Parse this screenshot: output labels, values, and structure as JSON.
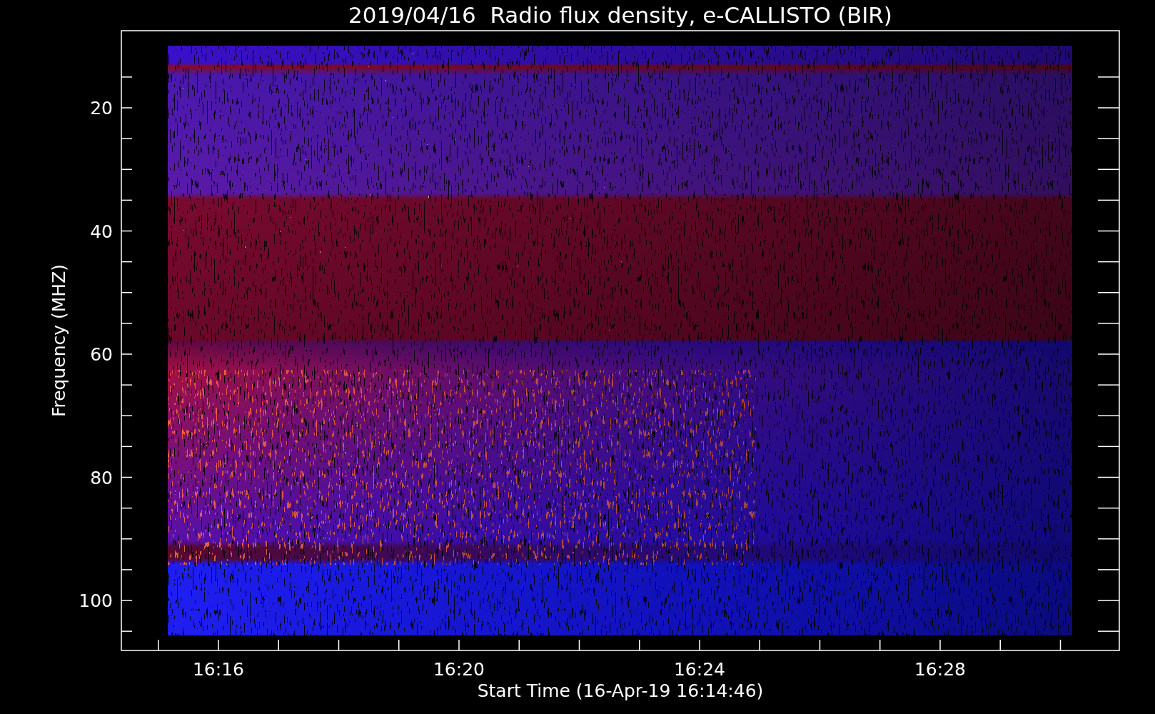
{
  "title": "2019/04/16  Radio flux density, e-CALLISTO (BIR)",
  "y_axis": {
    "label": "Frequency (MHZ)",
    "ticks": [
      "20",
      "40",
      "60",
      "80",
      "100"
    ]
  },
  "x_axis": {
    "label": "Start Time (16-Apr-19 16:14:46)",
    "ticks": [
      "16:16",
      "16:20",
      "16:24",
      "16:28"
    ]
  }
}
